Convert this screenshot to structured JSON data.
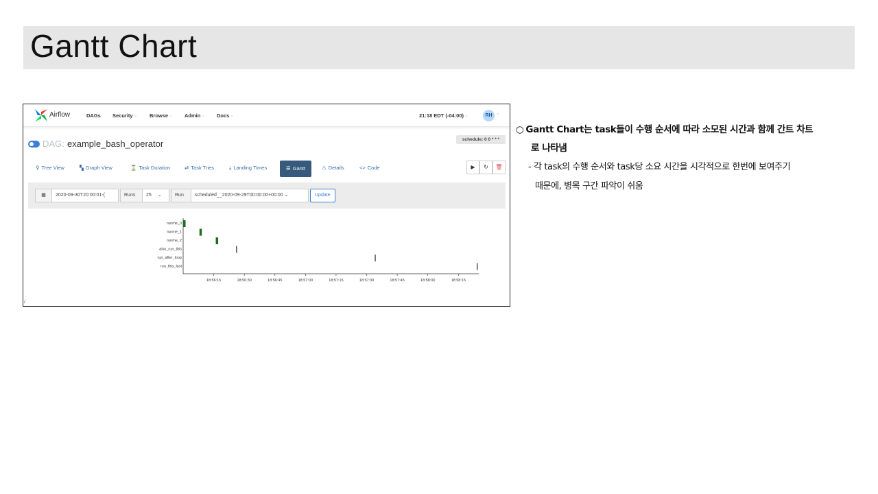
{
  "slide": {
    "title": "Gantt Chart"
  },
  "airflow": {
    "logo_text": "Airflow",
    "nav": [
      {
        "label": "DAGs",
        "caret": ""
      },
      {
        "label": "Security",
        "caret": "~"
      },
      {
        "label": "Browse",
        "caret": "~"
      },
      {
        "label": "Admin",
        "caret": "~"
      },
      {
        "label": "Docs",
        "caret": "~"
      }
    ],
    "time": "21:18 EDT (-04:00)",
    "time_caret": "~",
    "avatar": "RH",
    "avatar_caret": "~",
    "dag_label": "DAG:",
    "dag_name": "example_bash_operator",
    "schedule": "schedule: 0 0 * * *",
    "tabs": [
      {
        "label": "Tree View",
        "icon": "tree-icon",
        "glyph": "⚲"
      },
      {
        "label": "Graph View",
        "icon": "graph-icon",
        "glyph": "▚"
      },
      {
        "label": "Task Duration",
        "icon": "hourglass-icon",
        "glyph": "⌛"
      },
      {
        "label": "Task Tries",
        "icon": "retry-icon",
        "glyph": "⇄"
      },
      {
        "label": "Landing Times",
        "icon": "landing-icon",
        "glyph": "⤓"
      },
      {
        "label": "Gantt",
        "icon": "gantt-icon",
        "glyph": "☰"
      },
      {
        "label": "Details",
        "icon": "warning-icon",
        "glyph": "⚠"
      },
      {
        "label": "Code",
        "icon": "code-icon",
        "glyph": "<>"
      }
    ],
    "actions": [
      {
        "name": "trigger-dag-button",
        "icon": "play-icon",
        "glyph": "▶"
      },
      {
        "name": "refresh-button",
        "icon": "refresh-icon",
        "glyph": "↻"
      },
      {
        "name": "delete-dag-button",
        "icon": "trash-icon",
        "glyph": "🗑"
      }
    ],
    "filter": {
      "calendar_glyph": "▦",
      "date_value": "2020-09-30T20:00:01-(",
      "runs_label": "Runs",
      "runs_value": "25",
      "select_caret": "⌄",
      "run_label": "Run",
      "run_value": "scheduled__2020-09-29T00:00:00+00:00",
      "update_label": "Update"
    },
    "slash_mark": "/"
  },
  "chart_data": {
    "type": "gantt",
    "tasks": [
      "runme_0",
      "runme_1",
      "runme_2",
      "also_run_this",
      "run_after_loop",
      "run_this_last"
    ],
    "intervals": [
      {
        "task": "runme_0",
        "start": "18:56:00",
        "end": "18:56:01"
      },
      {
        "task": "runme_1",
        "start": "18:56:08",
        "end": "18:56:09"
      },
      {
        "task": "runme_2",
        "start": "18:56:16",
        "end": "18:56:17"
      },
      {
        "task": "also_run_this",
        "start": "18:56:26",
        "end": "18:56:26"
      },
      {
        "task": "run_after_loop",
        "start": "18:57:34",
        "end": "18:57:34"
      },
      {
        "task": "run_this_last",
        "start": "18:58:24",
        "end": "18:58:24"
      }
    ],
    "x_ticks": [
      "18:56:15",
      "18:56:30",
      "18:56:45",
      "18:57:00",
      "18:57:15",
      "18:57:30",
      "18:57:45",
      "18:58:00",
      "18:58:15"
    ],
    "x_range": [
      "18:56:00",
      "18:58:25"
    ],
    "colors": {
      "success": "#1d6b1d",
      "axis": "#333333"
    }
  },
  "notes": {
    "circle": "○",
    "bullet1_line1": "Gantt Chart는 task들이 수행 순서에 따라 소모된 시간과 함께 간트 차트",
    "bullet1_line2": "로 나타냄",
    "bullet2_line1": "- 각 task의 수행 순서와 task당 소요 시간을 시각적으로 한번에 보여주기",
    "bullet2_line2": "때문에, 병목 구간 파악이 쉬움"
  }
}
